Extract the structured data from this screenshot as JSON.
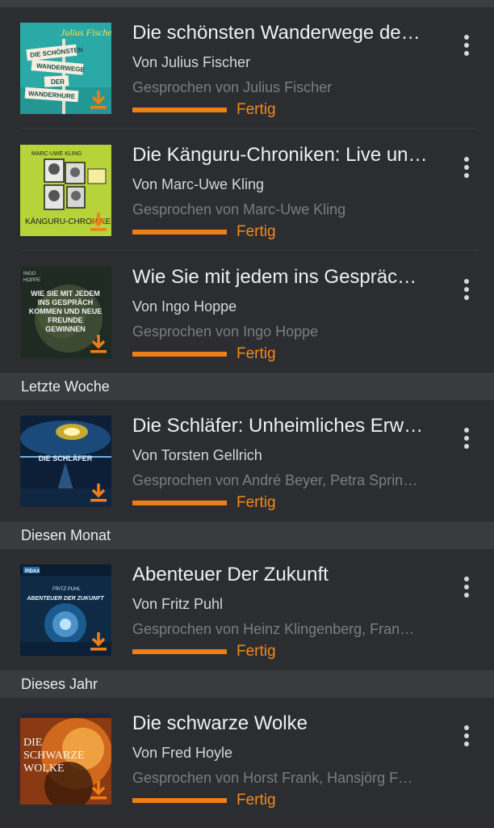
{
  "sections": [
    {
      "label": ""
    },
    {
      "label": "Letzte Woche"
    },
    {
      "label": "Diesen Monat"
    },
    {
      "label": "Dieses Jahr"
    }
  ],
  "items": [
    {
      "title": "Die schönsten Wanderwege de…",
      "author": "Von Julius Fischer",
      "narrator": "Gesprochen von Julius Fischer",
      "status": "Fertig",
      "progress": 1.0,
      "cover_text": [
        "Julius Fischer",
        "DIE SCHÖNSTEN",
        "WANDERWEGE",
        "DER",
        "WANDERHURE"
      ]
    },
    {
      "title": "Die Känguru-Chroniken: Live un…",
      "author": "Von Marc-Uwe Kling",
      "narrator": "Gesprochen von Marc-Uwe Kling",
      "status": "Fertig",
      "progress": 1.0,
      "cover_text": [
        "MARC-UWE KLING",
        "KÄNGURU-CHRONIKEN"
      ]
    },
    {
      "title": "Wie Sie mit jedem ins Gespräc…",
      "author": "Von Ingo Hoppe",
      "narrator": "Gesprochen von Ingo Hoppe",
      "status": "Fertig",
      "progress": 1.0,
      "cover_text": [
        "INGO",
        "HOPPE",
        "WIE SIE MIT JEDEM",
        "INS GESPRÄCH",
        "KOMMEN UND NEUE",
        "FREUNDE",
        "GEWINNEN"
      ]
    },
    {
      "title": "Die Schläfer: Unheimliches Erw…",
      "author": "Von Torsten Gellrich",
      "narrator": "Gesprochen von André Beyer, Petra Sprin…",
      "status": "Fertig",
      "progress": 1.0,
      "cover_text": [
        "DIE SCHLÄFER"
      ]
    },
    {
      "title": "Abenteuer Der Zukunft",
      "author": "Von Fritz Puhl",
      "narrator": "Gesprochen von Heinz Klingenberg, Fran…",
      "status": "Fertig",
      "progress": 1.0,
      "cover_text": [
        "PIDAX",
        "FRITZ PUHL",
        "ABENTEUER DER ZUKUNFT"
      ]
    },
    {
      "title": "Die schwarze Wolke",
      "author": "Von Fred Hoyle",
      "narrator": "Gesprochen von Horst Frank, Hansjörg F…",
      "status": "Fertig",
      "progress": 1.0,
      "cover_text": [
        "DIE",
        "SCHWARZE",
        "WOLKE"
      ]
    }
  ],
  "icons": {
    "download": "download-icon",
    "more": "more-vertical-icon"
  },
  "colors": {
    "accent": "#f07e16",
    "background": "#2c2d30",
    "section_header": "#3a3b3e"
  }
}
